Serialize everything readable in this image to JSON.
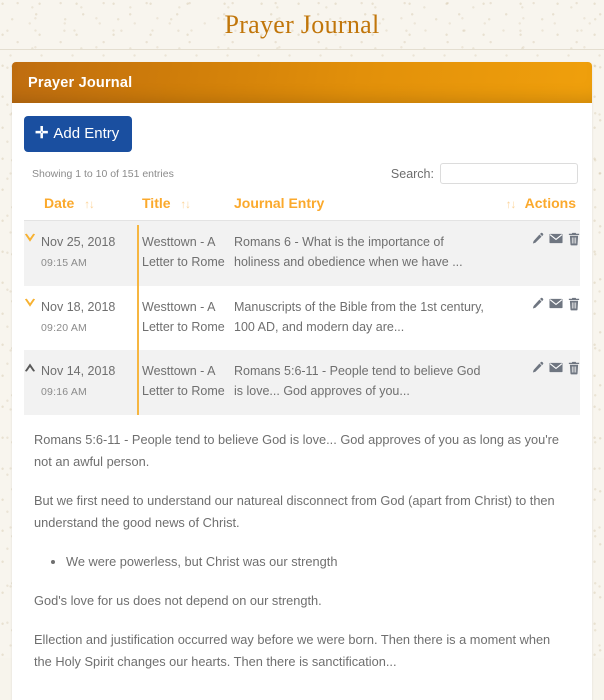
{
  "site": {
    "title": "Prayer Journal",
    "title_color": "#c1760a"
  },
  "card": {
    "header_title": "Prayer Journal",
    "header_gradient_from": "#bf6d10",
    "header_gradient_to": "#f0a00c"
  },
  "toolbar": {
    "add_entry_label": "Add Entry",
    "add_entry_icon": "plus-icon",
    "add_entry_color": "#1a4fa0"
  },
  "table_controls": {
    "info_text": "Showing 1 to 10 of 151 entries",
    "search_label": "Search:",
    "search_value": "",
    "search_placeholder": ""
  },
  "table": {
    "accent_color": "#fba92c",
    "rule_color": "#f6b641",
    "columns": [
      {
        "key": "date",
        "label": "Date",
        "sortable": true,
        "sort_icon": "↑↓"
      },
      {
        "key": "title",
        "label": "Title",
        "sortable": true,
        "sort_icon": "↑↓"
      },
      {
        "key": "entry",
        "label": "Journal Entry",
        "sortable": true,
        "sort_icon": "↑↓"
      },
      {
        "key": "actions",
        "label": "Actions",
        "sortable": true,
        "sort_icon": "↑↓"
      }
    ],
    "rows": [
      {
        "date": "Nov 25, 2018",
        "time": "09:15 AM",
        "title": "Westtown - A Letter to Rome",
        "entry": "Romans 6 - What is the importance of holiness and obedience when we have ...",
        "expanded": false,
        "toggle_icon": "chevron-down-icon",
        "toggle_color": "#f7b233",
        "stripe": "alt",
        "actions": [
          "edit-pencil-icon",
          "email-envelope-icon",
          "delete-trash-icon"
        ]
      },
      {
        "date": "Nov 18, 2018",
        "time": "09:20 AM",
        "title": "Westtown - A Letter to Rome",
        "entry": "Manuscripts of the Bible from the 1st century, 100 AD, and modern day are...",
        "expanded": false,
        "toggle_icon": "chevron-down-icon",
        "toggle_color": "#f7b233",
        "stripe": "plain",
        "actions": [
          "edit-pencil-icon",
          "email-envelope-icon",
          "delete-trash-icon"
        ]
      },
      {
        "date": "Nov 14, 2018",
        "time": "09:16 AM",
        "title": "Westtown - A Letter to Rome",
        "entry": "Romans 5:6-11 - People tend to believe God is love... God approves of you...",
        "expanded": true,
        "toggle_icon": "chevron-up-icon",
        "toggle_color": "#5a5a5a",
        "stripe": "alt",
        "actions": [
          "edit-pencil-icon",
          "email-envelope-icon",
          "delete-trash-icon"
        ]
      }
    ]
  },
  "detail": {
    "blocks": [
      {
        "type": "p",
        "text": "Romans 5:6-11 - People tend to believe God is love... God approves of you as long as you're not an awful person."
      },
      {
        "type": "p",
        "text": "But we first need to understand our natureal disconnect from God (apart from Christ) to then understand the good news of Christ."
      },
      {
        "type": "li",
        "text": "We were powerless, but Christ was our strength"
      },
      {
        "type": "p",
        "text": "God's love for us does not depend on our strength."
      },
      {
        "type": "p",
        "text": "Ellection and justification occurred way before we were born. Then there is a moment when the Holy Spirit changes our hearts. Then there is sanctification..."
      }
    ]
  }
}
